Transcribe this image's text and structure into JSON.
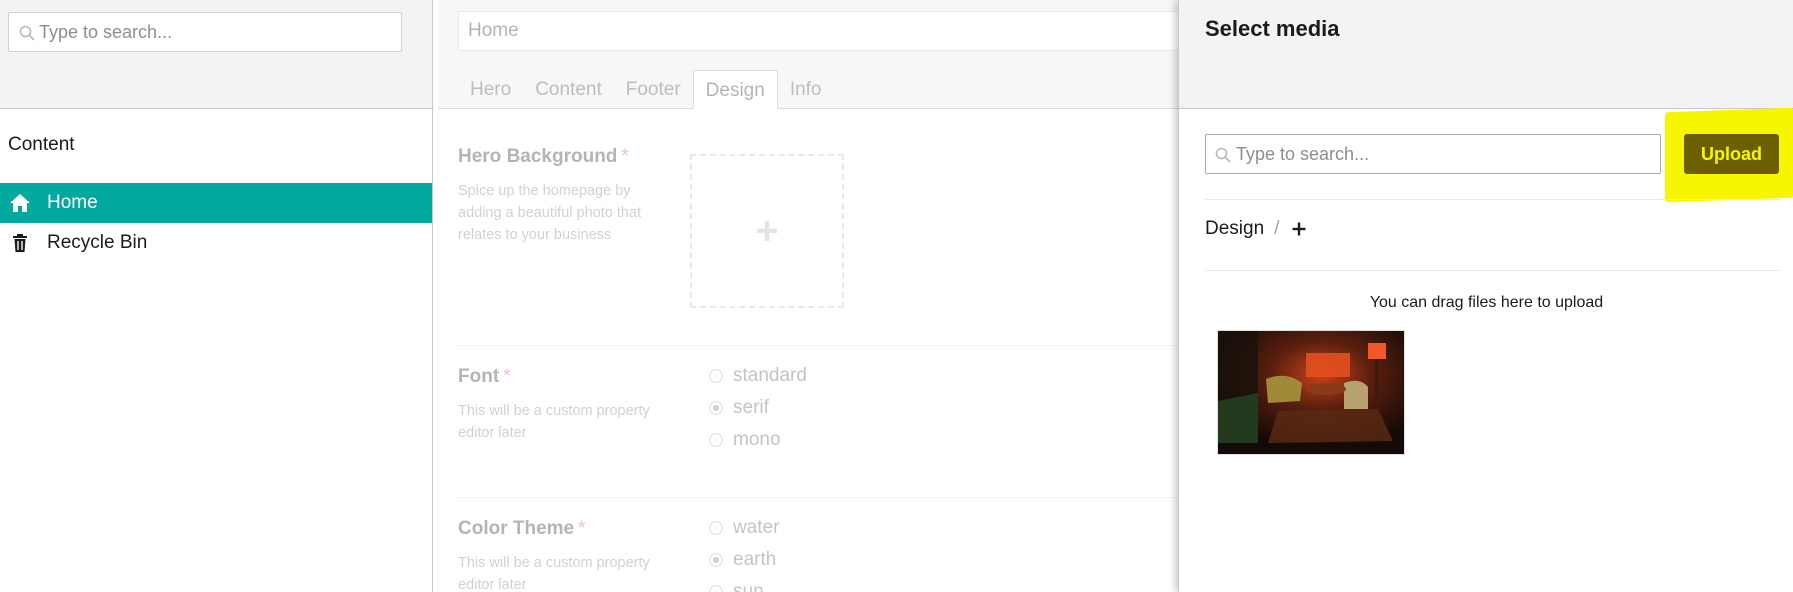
{
  "tree": {
    "search": {
      "placeholder": "Type to search..."
    },
    "section_title": "Content",
    "items": [
      {
        "label": "Home",
        "icon": "home-icon",
        "active": true
      },
      {
        "label": "Recycle Bin",
        "icon": "trash-icon",
        "active": false
      }
    ]
  },
  "editor": {
    "node_name": "Home",
    "tabs": [
      {
        "label": "Hero",
        "active": false
      },
      {
        "label": "Content",
        "active": false
      },
      {
        "label": "Footer",
        "active": false
      },
      {
        "label": "Design",
        "active": true
      },
      {
        "label": "Info",
        "active": false
      }
    ],
    "properties": [
      {
        "label": "Hero Background",
        "required_mark": "*",
        "description": "Spice up the homepage by adding a beautiful photo that relates to your business"
      },
      {
        "label": "Font",
        "required_mark": "*",
        "description": "This will be a custom property editor later",
        "options": [
          {
            "label": "standard",
            "checked": false
          },
          {
            "label": "serif",
            "checked": true
          },
          {
            "label": "mono",
            "checked": false
          }
        ]
      },
      {
        "label": "Color Theme",
        "required_mark": "*",
        "description": "This will be a custom property editor later",
        "options": [
          {
            "label": "water",
            "checked": false
          },
          {
            "label": "earth",
            "checked": true
          },
          {
            "label": "sun",
            "checked": false
          }
        ]
      }
    ]
  },
  "media_picker": {
    "title": "Select media",
    "search": {
      "placeholder": "Type to search..."
    },
    "upload_label": "Upload",
    "breadcrumb": {
      "folder": "Design",
      "separator": "/"
    },
    "drag_hint": "You can drag files here to upload"
  },
  "colors": {
    "accent": "#03a89e",
    "upload_bg": "#6b5f00",
    "upload_text": "#f7f600",
    "highlight": "#f7f600"
  }
}
